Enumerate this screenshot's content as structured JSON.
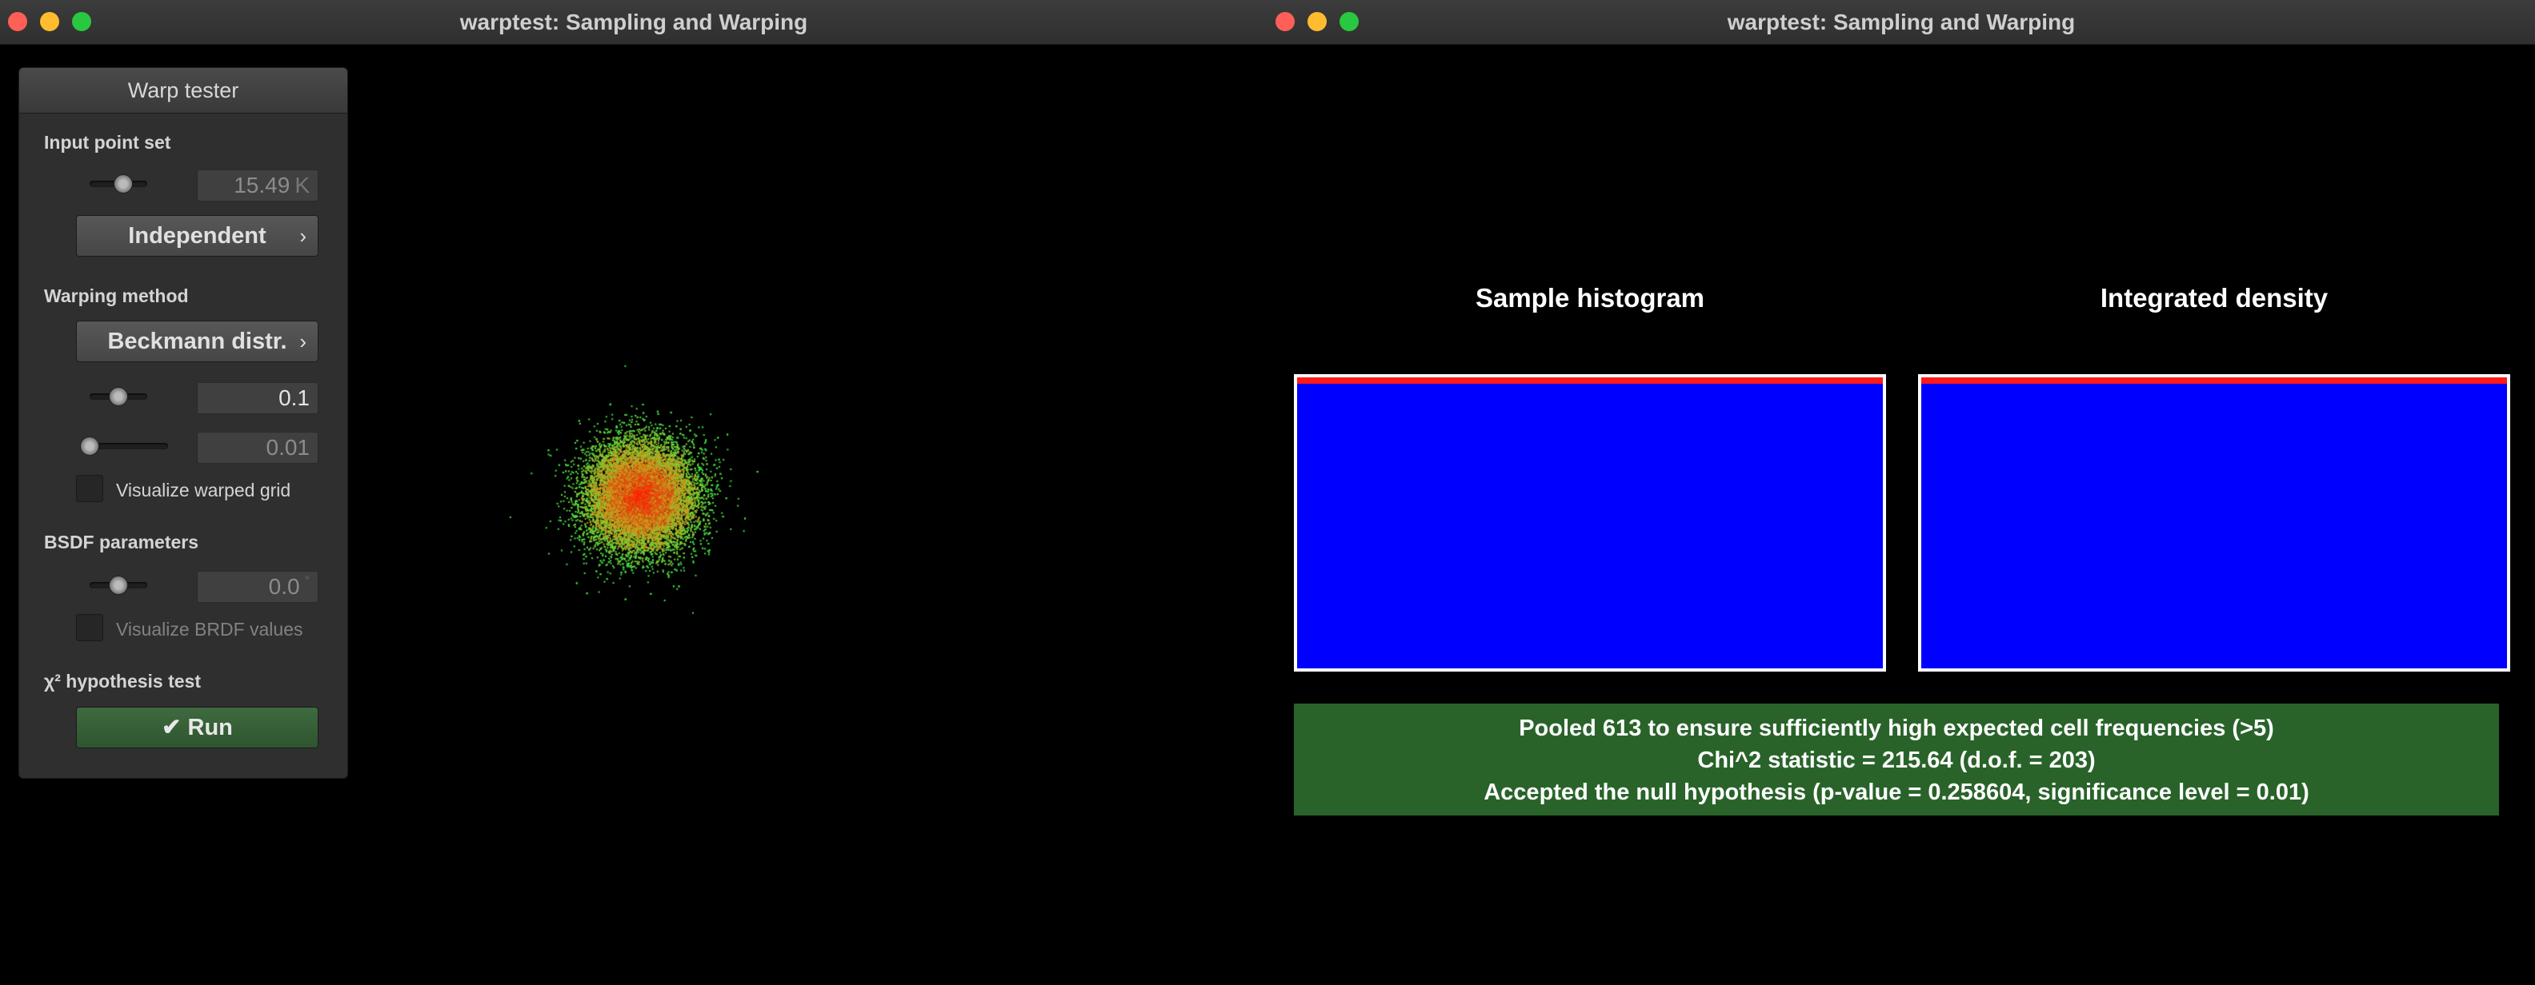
{
  "windows": [
    {
      "title": "warptest: Sampling and Warping"
    },
    {
      "title": "warptest: Sampling and Warping"
    }
  ],
  "panel": {
    "title": "Warp tester",
    "input": {
      "section_label": "Input point set",
      "point_count_value": "15.49",
      "point_count_unit": "K",
      "point_count_slider_level": 0.55,
      "point_type_button": "Independent"
    },
    "warp": {
      "section_label": "Warping method",
      "method_button": "Beckmann distr.",
      "param1_value": "0.1",
      "param1_slider_level": 0.5,
      "param2_value": "0.01",
      "param2_slider_level": 0.0,
      "visualize_grid_label": "Visualize warped grid",
      "visualize_grid_checked": false
    },
    "bsdf": {
      "section_label": "BSDF parameters",
      "angle_value": "0.0",
      "angle_unit": "°",
      "angle_slider_level": 0.5,
      "visualize_brdf_label": "Visualize BRDF values",
      "visualize_brdf_checked": false
    },
    "test": {
      "section_label": "χ² hypothesis test",
      "run_icon": "check-icon",
      "run_label": "Run"
    }
  },
  "scatter": {
    "colors": [
      "#ff2200",
      "#e04f10",
      "#c89a1c",
      "#7fcc33",
      "#44dd44"
    ]
  },
  "histograms": {
    "sample_title": "Sample histogram",
    "density_title": "Integrated density",
    "fill_color": "#0000ff",
    "edge_color": "#ff1a1a"
  },
  "result": {
    "line1": "Pooled 613 to ensure sufficiently high expected cell frequencies (>5)",
    "line2": "Chi^2 statistic = 215.64 (d.o.f. = 203)",
    "line3": "Accepted the null hypothesis (p-value = 0.258604, significance level = 0.01)",
    "color": "#29632a"
  }
}
